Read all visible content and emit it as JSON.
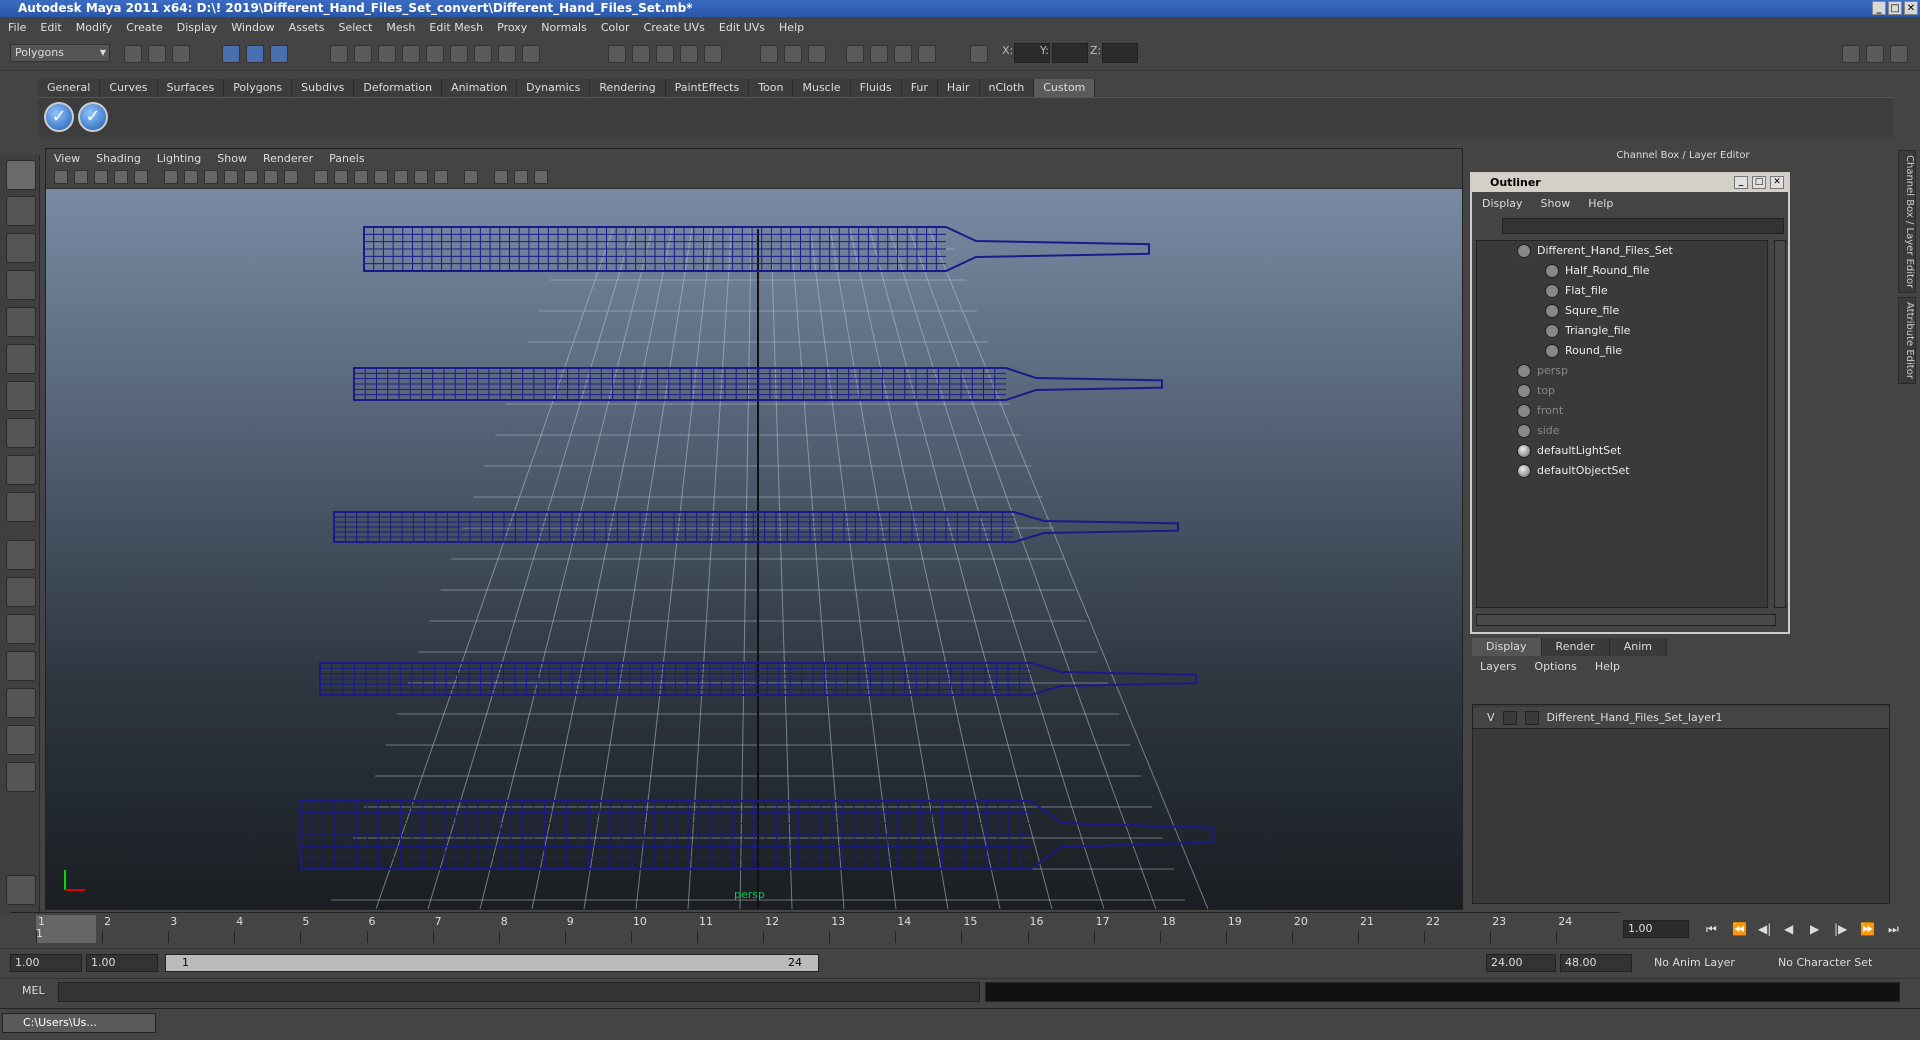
{
  "window": {
    "title": "Autodesk Maya 2011 x64: D:\\! 2019\\Different_Hand_Files_Set_convert\\Different_Hand_Files_Set.mb*"
  },
  "menubar": [
    "File",
    "Edit",
    "Modify",
    "Create",
    "Display",
    "Window",
    "Assets",
    "Select",
    "Mesh",
    "Edit Mesh",
    "Proxy",
    "Normals",
    "Color",
    "Create UVs",
    "Edit UVs",
    "Help"
  ],
  "statusline": {
    "mode": "Polygons",
    "x_label": "X:",
    "y_label": "Y:",
    "z_label": "Z:"
  },
  "shelf": {
    "tabs": [
      "General",
      "Curves",
      "Surfaces",
      "Polygons",
      "Subdivs",
      "Deformation",
      "Animation",
      "Dynamics",
      "Rendering",
      "PaintEffects",
      "Toon",
      "Muscle",
      "Fluids",
      "Fur",
      "Hair",
      "nCloth",
      "Custom"
    ],
    "active": "Custom"
  },
  "viewport": {
    "menu": [
      "View",
      "Shading",
      "Lighting",
      "Show",
      "Renderer",
      "Panels"
    ],
    "camera_label": "persp",
    "wire_color": "#1a1a8c"
  },
  "channel_box": {
    "title": "Channel Box / Layer Editor"
  },
  "outliner": {
    "title": "Outliner",
    "menu": [
      "Display",
      "Show",
      "Help"
    ],
    "items": [
      {
        "label": "Different_Hand_Files_Set",
        "indent": 0,
        "dim": false
      },
      {
        "label": "Half_Round_file",
        "indent": 1,
        "dim": false
      },
      {
        "label": "Flat_file",
        "indent": 1,
        "dim": false
      },
      {
        "label": "Squre_file",
        "indent": 1,
        "dim": false
      },
      {
        "label": "Triangle_file",
        "indent": 1,
        "dim": false
      },
      {
        "label": "Round_file",
        "indent": 1,
        "dim": false
      },
      {
        "label": "persp",
        "indent": 0,
        "dim": true
      },
      {
        "label": "top",
        "indent": 0,
        "dim": true
      },
      {
        "label": "front",
        "indent": 0,
        "dim": true
      },
      {
        "label": "side",
        "indent": 0,
        "dim": true
      },
      {
        "label": "defaultLightSet",
        "indent": 0,
        "dim": false
      },
      {
        "label": "defaultObjectSet",
        "indent": 0,
        "dim": false
      }
    ]
  },
  "layer_editor": {
    "tabs": [
      "Display",
      "Render",
      "Anim"
    ],
    "menu": [
      "Layers",
      "Options",
      "Help"
    ],
    "layer": {
      "visible": "V",
      "name": "Different_Hand_Files_Set_layer1"
    }
  },
  "side_tabs": [
    "Channel Box / Layer Editor",
    "Attribute Editor"
  ],
  "timeline": {
    "frames": [
      "1",
      "2",
      "3",
      "4",
      "5",
      "6",
      "7",
      "8",
      "9",
      "10",
      "11",
      "12",
      "13",
      "14",
      "15",
      "16",
      "17",
      "18",
      "19",
      "20",
      "21",
      "22",
      "23",
      "24"
    ],
    "current": "1.00",
    "cur_label": "1"
  },
  "range": {
    "start": "1.00",
    "start2": "1.00",
    "slider_left": "1",
    "slider_right": "24",
    "end": "24.00",
    "end2": "48.00",
    "anim_layer": "No Anim Layer",
    "char_set": "No Character Set"
  },
  "cmdline": {
    "label": "MEL"
  },
  "taskbar": {
    "task": "C:\\Users\\Us..."
  }
}
